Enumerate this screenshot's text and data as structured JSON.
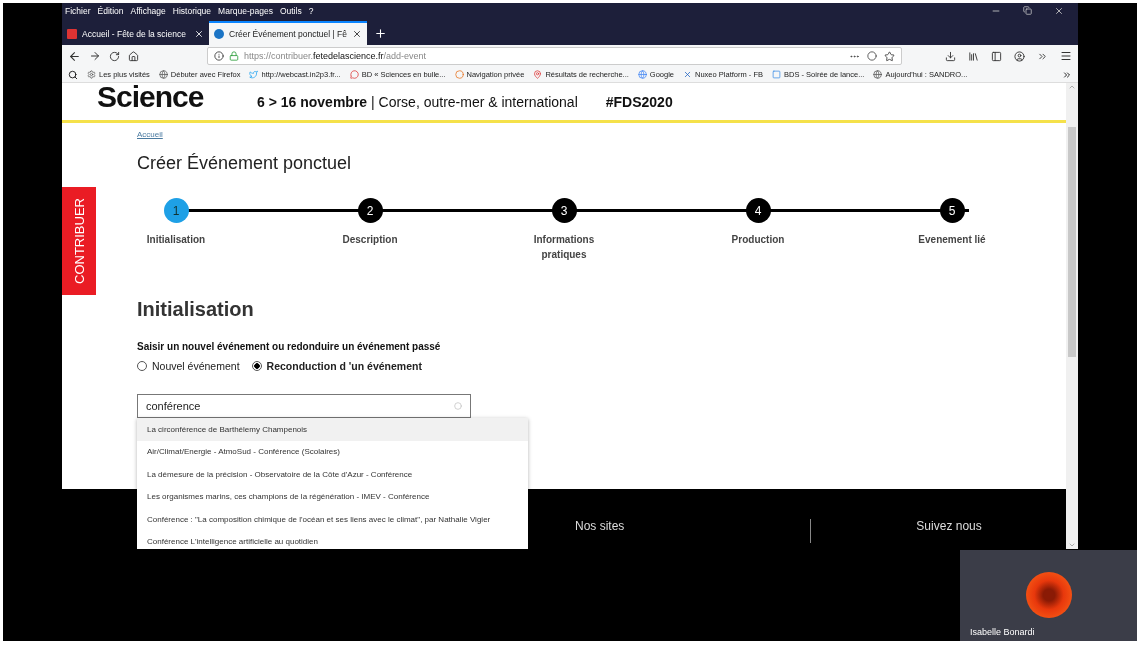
{
  "browser": {
    "menu": [
      "Fichier",
      "Édition",
      "Affichage",
      "Historique",
      "Marque-pages",
      "Outils",
      "?"
    ],
    "tabs": [
      {
        "title": "Accueil - Fête de la science",
        "selected": false
      },
      {
        "title": "Créer Événement ponctuel | Fê",
        "selected": true
      }
    ],
    "url": {
      "prefix": "https://contribuer.",
      "domain": "fetedelascience.fr",
      "path": "/add-event"
    },
    "bookmarks": [
      "Les plus visités",
      "Débuter avec Firefox",
      "http://webcast.in2p3.fr...",
      "BD « Sciences en bulle...",
      "Navigation privée",
      "Résultats de recherche...",
      "Google",
      "Nuxeo Platform - FB",
      "BDS - Soirée de lance...",
      "Aujourd'hui : SANDRO..."
    ]
  },
  "page": {
    "logo": "Science",
    "dates": "6 > 16 novembre",
    "places": "| Corse, outre-mer & international",
    "hashtag": "#FDS2020",
    "side_tab": "CONTRIBUER",
    "breadcrumb": "Accueil",
    "title": "Créer Événement ponctuel",
    "steps": [
      {
        "number": "1",
        "label": "Initialisation",
        "selected": true
      },
      {
        "number": "2",
        "label": "Description",
        "selected": false
      },
      {
        "number": "3",
        "label": "Informations pratiques",
        "selected": false
      },
      {
        "number": "4",
        "label": "Production",
        "selected": false
      },
      {
        "number": "5",
        "label": "Evenement lié",
        "selected": false
      }
    ],
    "section_title": "Initialisation",
    "question": "Saisir un nouvel événement ou redonduire un événement passé",
    "options": [
      {
        "label": "Nouvel événement",
        "selected": false
      },
      {
        "label": "Reconduction d 'un événement",
        "selected": true
      }
    ],
    "search": {
      "value": "conférence"
    },
    "suggestions": [
      {
        "text": "La circonférence de Barthélemy Champenois",
        "selected": true
      },
      {
        "text": "Air/Climat/Energie - AtmoSud - Conférence (Scolaires)",
        "selected": false
      },
      {
        "text": "La démesure de la précision - Observatoire de la Côte d'Azur - Conférence",
        "selected": false
      },
      {
        "text": "Les organismes marins, ces champions de la régénération - IMEV - Conférence",
        "selected": false
      },
      {
        "text": "Conférence : \"La composition chimique de l'océan et ses liens avec le climat\", par Nathalie Vigier",
        "selected": false
      },
      {
        "text": "Conférence L'intelligence artificielle au quotidien",
        "selected": false
      }
    ],
    "footer": {
      "column_1": "Nos sites",
      "column_2": "Suivez nous"
    }
  },
  "participant": {
    "name": "Isabelle Bonardi"
  }
}
